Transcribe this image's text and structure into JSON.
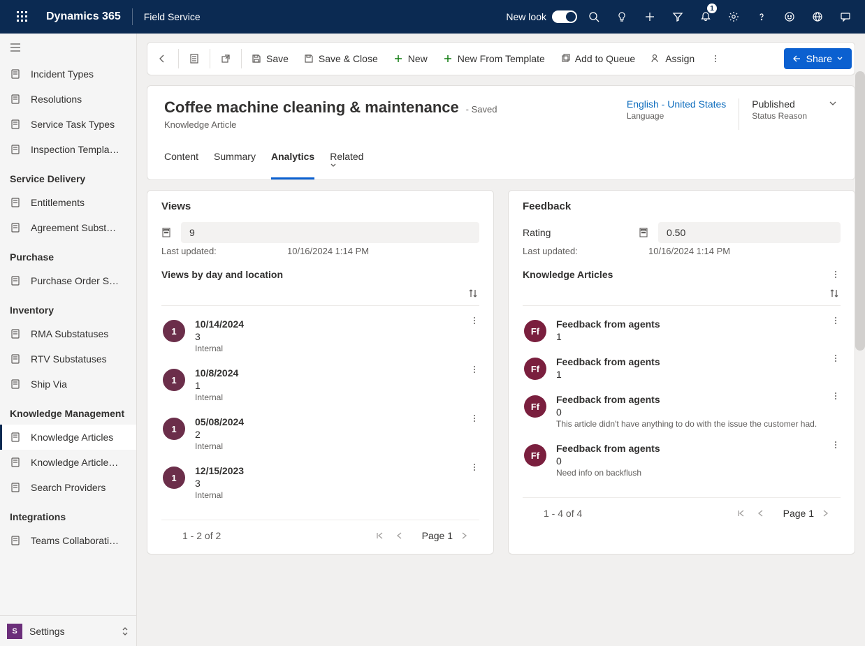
{
  "navbar": {
    "brand": "Dynamics 365",
    "app": "Field Service",
    "newlook": "New look",
    "notification_count": "1"
  },
  "sidebar": {
    "groups": [
      {
        "header": null,
        "items": [
          {
            "label": "Incident Types",
            "icon": "warning"
          },
          {
            "label": "Resolutions",
            "icon": "check-circle"
          },
          {
            "label": "Service Task Types",
            "icon": "wrench"
          },
          {
            "label": "Inspection Templa…",
            "icon": "doc"
          }
        ]
      },
      {
        "header": "Service Delivery",
        "items": [
          {
            "label": "Entitlements",
            "icon": "card"
          },
          {
            "label": "Agreement Subst…",
            "icon": "doc"
          }
        ]
      },
      {
        "header": "Purchase",
        "items": [
          {
            "label": "Purchase Order S…",
            "icon": "box"
          }
        ]
      },
      {
        "header": "Inventory",
        "items": [
          {
            "label": "RMA Substatuses",
            "icon": "doc"
          },
          {
            "label": "RTV Substatuses",
            "icon": "doc"
          },
          {
            "label": "Ship Via",
            "icon": "truck"
          }
        ]
      },
      {
        "header": "Knowledge Management",
        "items": [
          {
            "label": "Knowledge Articles",
            "icon": "doc",
            "selected": true
          },
          {
            "label": "Knowledge Article…",
            "icon": "doc"
          },
          {
            "label": "Search Providers",
            "icon": "gear"
          }
        ]
      },
      {
        "header": "Integrations",
        "items": [
          {
            "label": "Teams Collaborati…",
            "icon": "chat"
          }
        ]
      }
    ],
    "footer": {
      "tile": "S",
      "label": "Settings"
    }
  },
  "commands": {
    "save": "Save",
    "save_close": "Save & Close",
    "new": "New",
    "new_template": "New From Template",
    "queue": "Add to Queue",
    "assign": "Assign",
    "share": "Share"
  },
  "record": {
    "title": "Coffee machine cleaning & maintenance",
    "saved": "- Saved",
    "subtitle": "Knowledge Article",
    "language": {
      "value": "English - United States",
      "label": "Language"
    },
    "status": {
      "value": "Published",
      "label": "Status Reason"
    },
    "tabs": [
      "Content",
      "Summary",
      "Analytics",
      "Related"
    ],
    "active_tab": "Analytics"
  },
  "views": {
    "title": "Views",
    "count": "9",
    "last_updated_label": "Last updated:",
    "last_updated_value": "10/16/2024 1:14 PM",
    "sub_title": "Views by day and location",
    "items": [
      {
        "badge": "1",
        "date": "10/14/2024",
        "count": "3",
        "source": "Internal"
      },
      {
        "badge": "1",
        "date": "10/8/2024",
        "count": "1",
        "source": "Internal"
      },
      {
        "badge": "1",
        "date": "05/08/2024",
        "count": "2",
        "source": "Internal"
      },
      {
        "badge": "1",
        "date": "12/15/2023",
        "count": "3",
        "source": "Internal"
      }
    ],
    "pager": {
      "range": "1 - 2 of 2",
      "page": "Page 1"
    }
  },
  "feedback": {
    "title": "Feedback",
    "rating_label": "Rating",
    "rating_value": "0.50",
    "last_updated_label": "Last updated:",
    "last_updated_value": "10/16/2024 1:14 PM",
    "sub_title": "Knowledge Articles",
    "items": [
      {
        "badge": "Ff",
        "title": "Feedback from agents",
        "score": "1",
        "note": ""
      },
      {
        "badge": "Ff",
        "title": "Feedback from agents",
        "score": "1",
        "note": ""
      },
      {
        "badge": "Ff",
        "title": "Feedback from agents",
        "score": "0",
        "note": "This article didn't have anything to do with the issue the customer had."
      },
      {
        "badge": "Ff",
        "title": "Feedback from agents",
        "score": "0",
        "note": "Need info on backflush"
      }
    ],
    "pager": {
      "range": "1 - 4 of 4",
      "page": "Page 1"
    }
  }
}
